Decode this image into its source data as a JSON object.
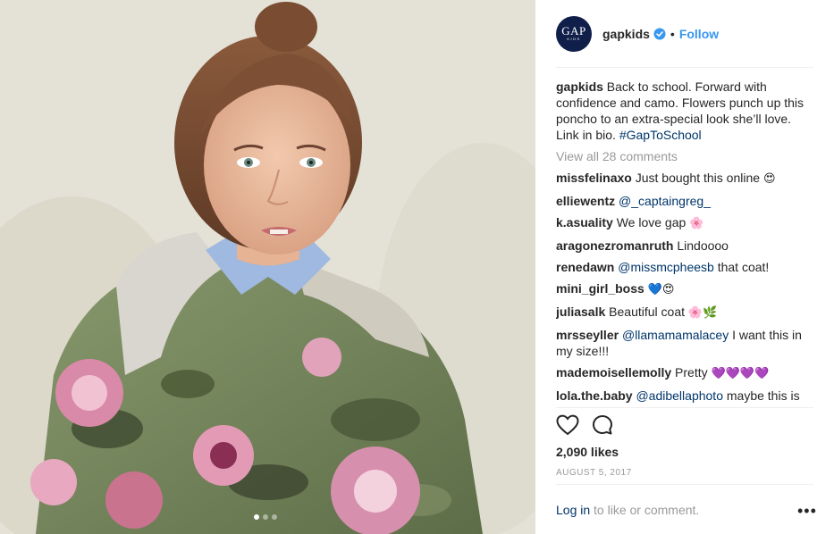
{
  "post": {
    "carousel": {
      "slide_count": 3,
      "active_index": 0
    },
    "account": {
      "username": "gapkids",
      "avatar_text": "GAP",
      "avatar_subtext": "KIDS",
      "verified": true,
      "separator": "•",
      "follow_label": "Follow"
    },
    "caption": {
      "username": "gapkids",
      "text": " Back to school. Forward with confidence and camo. Flowers punch up this poncho to an extra-special look she’ll love. Link in bio. ",
      "hashtag": "#GapToSchool"
    },
    "view_all_label": "View all 28 comments",
    "comments": [
      {
        "user": "missfelinaxo",
        "text": " Just bought this online ",
        "mention": "",
        "after": "",
        "emoji": "😍"
      },
      {
        "user": "elliewentz",
        "text": " ",
        "mention": "@_captaingreg_",
        "after": "",
        "emoji": ""
      },
      {
        "user": "k.asuality",
        "text": " We love gap ",
        "mention": "",
        "after": "",
        "emoji": "🌸"
      },
      {
        "user": "aragonezromanruth",
        "text": " Lindoooo",
        "mention": "",
        "after": "",
        "emoji": ""
      },
      {
        "user": "renedawn",
        "text": " ",
        "mention": "@missmcpheesb",
        "after": " that coat!",
        "emoji": ""
      },
      {
        "user": "mini_girl_boss",
        "text": " ",
        "mention": "",
        "after": "",
        "emoji": "💙😍"
      },
      {
        "user": "juliasalk",
        "text": " Beautiful coat ",
        "mention": "",
        "after": "",
        "emoji": "🌸🌿"
      },
      {
        "user": "mrsseyller",
        "text": " ",
        "mention": "@llamamamalacey",
        "after": " I want this in my size!!!",
        "emoji": ""
      },
      {
        "user": "mademoisellemolly",
        "text": " Pretty ",
        "mention": "",
        "after": "",
        "emoji": "💜💜💜💜"
      },
      {
        "user": "lola.the.baby",
        "text": " ",
        "mention": "@adibellaphoto",
        "after": " maybe this is what Lolo will look like?",
        "emoji": ""
      }
    ],
    "icons": {
      "like": "heart-icon",
      "comment": "comment-icon",
      "more": "more-icon"
    },
    "likes": "2,090 likes",
    "date": "AUGUST 5, 2017",
    "login": {
      "link_label": "Log in",
      "suffix": " to like or comment."
    },
    "more_label": "•••",
    "colors": {
      "link_blue": "#3897f0",
      "mention": "#003569",
      "muted": "#999999"
    }
  }
}
